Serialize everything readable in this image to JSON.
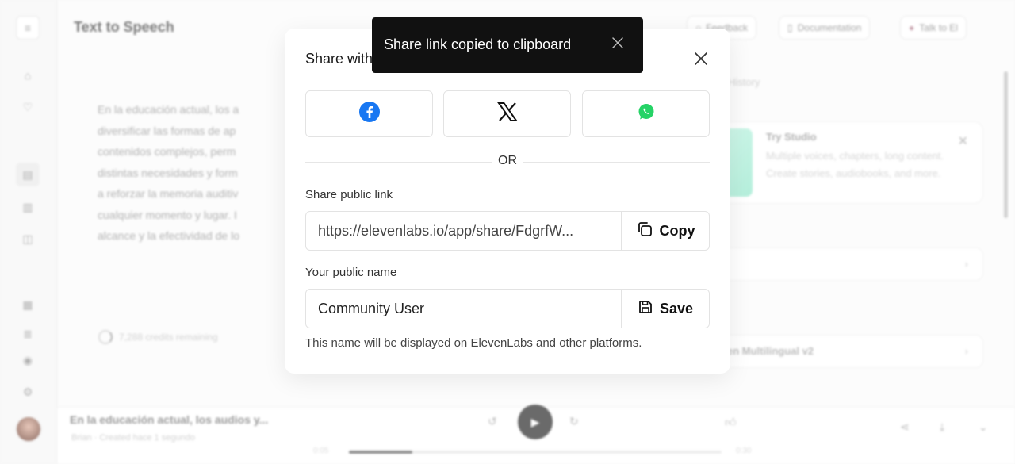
{
  "background": {
    "page_title": "Text to Speech",
    "header_buttons": [
      "Feedback",
      "Documentation",
      "Talk to El"
    ],
    "editor_text": [
      "En la educación actual, los a",
      "diversificar las formas de ap",
      "contenidos complejos, perm",
      "distintas necesidades y form",
      "a reforzar la memoria auditiv",
      "cualquier momento y lugar. I",
      "alcance y la efectividad de lo"
    ],
    "credits": "7,288 credits remaining",
    "history_tab": "History",
    "studio_card": {
      "title": "Try Studio",
      "desc": "Multiple voices, chapters, long content. Create stories, audiobooks, and more."
    },
    "model_row": "en Multilingual v2",
    "player": {
      "title": "En la educación actual, los audios y...",
      "subtitle": "Brian · Created hace 1 segundo",
      "time_start": "0:05",
      "time_end": "0:30",
      "progress": 0.17
    }
  },
  "modal": {
    "title": "Share with",
    "or_text": "OR",
    "public_link_label": "Share public link",
    "public_link_value": "https://elevenlabs.io/app/share/FdgrfW...",
    "copy_label": "Copy",
    "public_name_label": "Your public name",
    "public_name_value": "Community User",
    "save_label": "Save",
    "hint": "This name will be displayed on ElevenLabs and other platforms.",
    "social_icons": [
      "facebook-icon",
      "x-icon",
      "whatsapp-icon"
    ]
  },
  "toast": {
    "message": "Share link copied to clipboard"
  },
  "colors": {
    "facebook": "#1877F2",
    "whatsapp": "#25D366",
    "toast_bg": "#111111"
  }
}
